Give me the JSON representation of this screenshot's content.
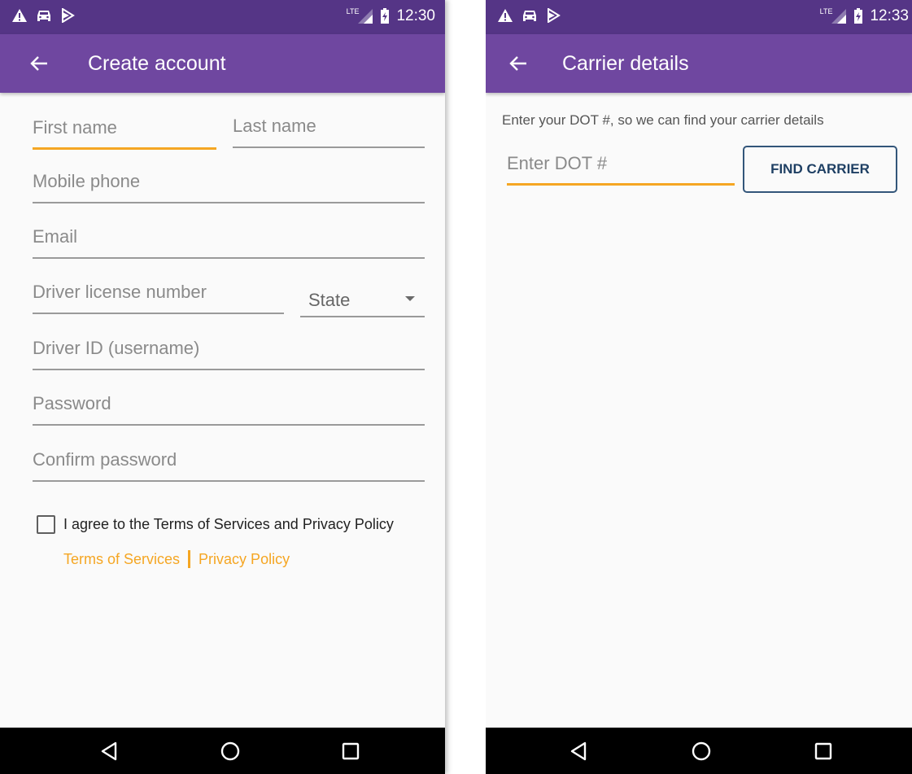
{
  "screen1": {
    "status_time": "12:30",
    "network": "LTE",
    "title": "Create account",
    "fields": {
      "first_name": "First name",
      "last_name": "Last name",
      "mobile_phone": "Mobile phone",
      "email": "Email",
      "license_number": "Driver license number",
      "state": "State",
      "driver_id": "Driver ID (username)",
      "password": "Password",
      "confirm_password": "Confirm password"
    },
    "agree_text": "I agree to the Terms of Services and Privacy Policy",
    "terms_link": "Terms of Services",
    "privacy_link": "Privacy Policy"
  },
  "screen2": {
    "status_time": "12:33",
    "network": "LTE",
    "title": "Carrier details",
    "description": "Enter your DOT #, so we can find your carrier details",
    "dot_placeholder": "Enter DOT #",
    "find_button": "FIND CARRIER"
  },
  "colors": {
    "status_bar": "#553586",
    "app_bar": "#6f47a0",
    "accent": "#f5a623",
    "button_border": "#33567a"
  },
  "icons": [
    "warning-icon",
    "car-icon",
    "play-store-icon",
    "signal-icon",
    "battery-icon",
    "back-arrow-icon",
    "nav-back-icon",
    "nav-home-icon",
    "nav-recents-icon"
  ]
}
